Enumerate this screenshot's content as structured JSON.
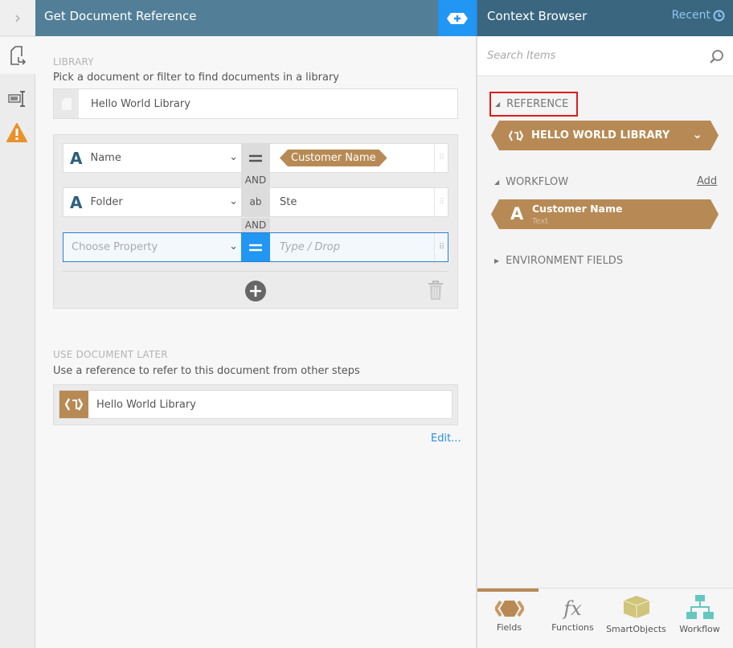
{
  "left_panel": {
    "title": "Get Document Reference",
    "library": {
      "label": "LIBRARY",
      "description": "Pick a document or filter to find documents in a library",
      "value": "Hello World Library"
    },
    "filters": [
      {
        "property": "Name",
        "operator": "equals",
        "value_chip": "Customer Name"
      },
      {
        "property": "Folder",
        "operator": "contains",
        "value": "Ste"
      },
      {
        "property_placeholder": "Choose Property",
        "operator": "equals",
        "value_placeholder": "Type / Drop"
      }
    ],
    "joiner": "AND",
    "use_later": {
      "label": "USE DOCUMENT LATER",
      "description": "Use a reference to refer to this document from other steps",
      "value": "Hello World Library",
      "edit_link": "Edit..."
    }
  },
  "context_browser": {
    "title": "Context Browser",
    "recent": "Recent",
    "search_placeholder": "Search Items",
    "sections": {
      "reference": "REFERENCE",
      "workflow": "WORKFLOW",
      "workflow_add": "Add",
      "environment": "ENVIRONMENT FIELDS"
    },
    "reference_item": "HELLO WORLD LIBRARY",
    "workflow_item": {
      "name": "Customer Name",
      "type": "Text"
    },
    "tabs": [
      {
        "label": "Fields"
      },
      {
        "label": "Functions"
      },
      {
        "label": "SmartObjects"
      },
      {
        "label": "Workflow"
      }
    ]
  },
  "colors": {
    "header": "#527f97",
    "accent": "#2196f3",
    "chip": "#b78a55",
    "warning": "#e8922e"
  }
}
